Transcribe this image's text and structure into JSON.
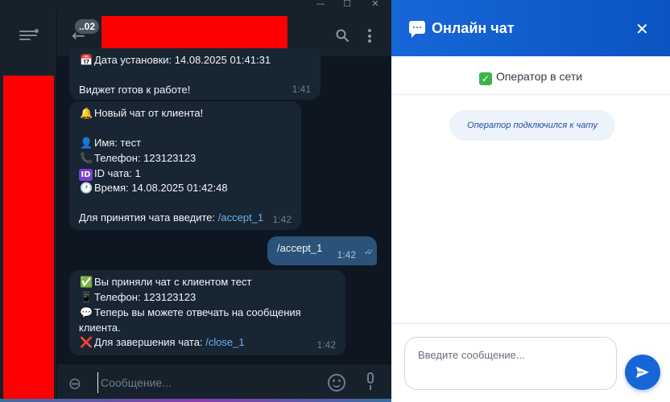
{
  "colors": {
    "telegram_bg": "#0e1621",
    "telegram_panel": "#17212b",
    "incoming_bubble": "#182533",
    "outgoing_bubble": "#2b5278",
    "link": "#6ab3f3",
    "widget_header": "#1766d8",
    "online_green": "#3ab54a"
  },
  "telegram": {
    "window_controls": {
      "minimize": "—",
      "maximize": "☐",
      "close": "✕"
    },
    "unread_badge": "..02",
    "icons": {
      "menu": "hamburger-menu-icon",
      "back": "arrow-left-icon",
      "search": "search-icon",
      "more": "more-vertical-icon",
      "attach": "paperclip-icon",
      "emoji": "smile-icon",
      "mic": "microphone-icon"
    },
    "messages": [
      {
        "emoji": [
          "📅",
          ""
        ],
        "lines": [
          "Дата установки: 14.08.2025 01:41:31",
          "",
          "Виджет готов к работе!"
        ],
        "time": "1:41"
      },
      {
        "emoji": [
          "🔔",
          "",
          "👤",
          "📞",
          "🆔",
          "🕐",
          "",
          ""
        ],
        "lines": [
          "Новый чат от клиента!",
          "",
          "Имя: тест",
          "Телефон: 123123123",
          "ID чата: 1",
          "Время: 14.08.2025 01:42:48",
          "",
          "Для принятия чата введите:"
        ],
        "command": "/accept_1",
        "time": "1:42"
      },
      {
        "outgoing": true,
        "text": "/accept_1",
        "time": "1:42",
        "read_icon": "double-check-icon"
      },
      {
        "emoji": [
          "✅",
          "📱",
          "💬",
          "",
          "❌"
        ],
        "lines": [
          "Вы приняли чат с клиентом тест",
          "Телефон: 123123123",
          "Теперь вы можете отвечать на сообщения",
          "клиента.",
          "Для завершения чата:"
        ],
        "command": "/close_1",
        "time": "1:42"
      }
    ],
    "composer_placeholder": "Сообщение..."
  },
  "widget": {
    "title": "Онлайн чат",
    "header_icon": "chat-bubble-icon",
    "close_label": "✕",
    "status_check": "✓",
    "status_text": "Оператор в сети",
    "system_message": "Оператор подключился к чату",
    "input_placeholder": "Введите сообщение...",
    "send_icon": "send-icon"
  }
}
